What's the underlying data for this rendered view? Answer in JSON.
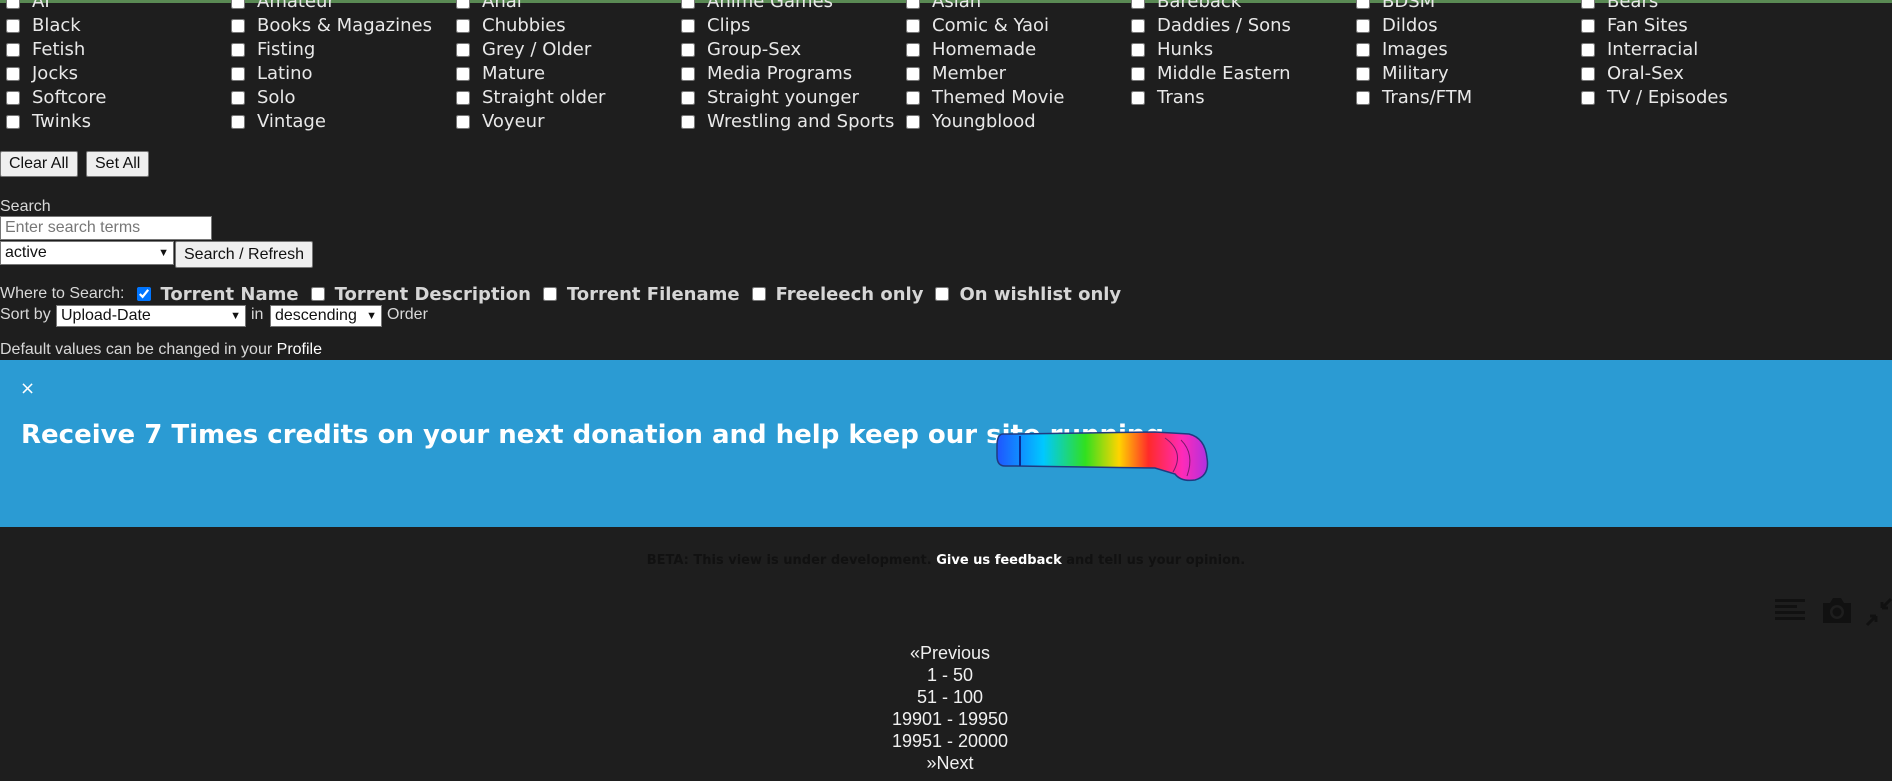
{
  "categories": [
    "AI",
    "Amateur",
    "Anal",
    "Anime Games",
    "Asian",
    "Bareback",
    "BDSM",
    "Bears",
    "Black",
    "Books & Magazines",
    "Chubbies",
    "Clips",
    "Comic & Yaoi",
    "Daddies / Sons",
    "Dildos",
    "Fan Sites",
    "Fetish",
    "Fisting",
    "Grey / Older",
    "Group-Sex",
    "Homemade",
    "Hunks",
    "Images",
    "Interracial",
    "Jocks",
    "Latino",
    "Mature",
    "Media Programs",
    "Member",
    "Middle Eastern",
    "Military",
    "Oral-Sex",
    "Softcore",
    "Solo",
    "Straight older",
    "Straight younger",
    "Themed Movie",
    "Trans",
    "Trans/FTM",
    "TV / Episodes",
    "Twinks",
    "Vintage",
    "Voyeur",
    "Wrestling and Sports",
    "Youngblood"
  ],
  "buttons": {
    "clear_all": "Clear All",
    "set_all": "Set All",
    "search_refresh": "Search / Refresh"
  },
  "search": {
    "label": "Search",
    "placeholder": "Enter search terms",
    "status_value": "active"
  },
  "where": {
    "label": "Where to Search:",
    "options": [
      {
        "label": "Torrent Name",
        "checked": true
      },
      {
        "label": "Torrent Description",
        "checked": false
      },
      {
        "label": "Torrent Filename",
        "checked": false
      },
      {
        "label": "Freeleech only",
        "checked": false
      },
      {
        "label": "On wishlist only",
        "checked": false
      }
    ]
  },
  "sort": {
    "label": "Sort by",
    "field": "Upload-Date",
    "in": "in",
    "order": "descending",
    "suffix": "Order"
  },
  "defaults": {
    "text": "Default values can be changed in your",
    "link": "Profile"
  },
  "banner": {
    "close": "×",
    "message": "Receive 7 Times credits on your next donation and help keep our site running."
  },
  "beta": {
    "prefix": "BETA: This view is under development.",
    "link": "Give us feedback",
    "suffix": "and tell us your opinion."
  },
  "toolbar": {
    "icons": [
      "list-icon",
      "camera-icon",
      "collapse-icon"
    ]
  },
  "pagination": {
    "previous": "«Previous",
    "pages": [
      "1 - 50",
      "51 - 100",
      "19901 - 19950",
      "19951 - 20000"
    ],
    "next": "»Next"
  },
  "colors": {
    "background": "#1e1e1e",
    "banner": "#2b9bd3"
  }
}
